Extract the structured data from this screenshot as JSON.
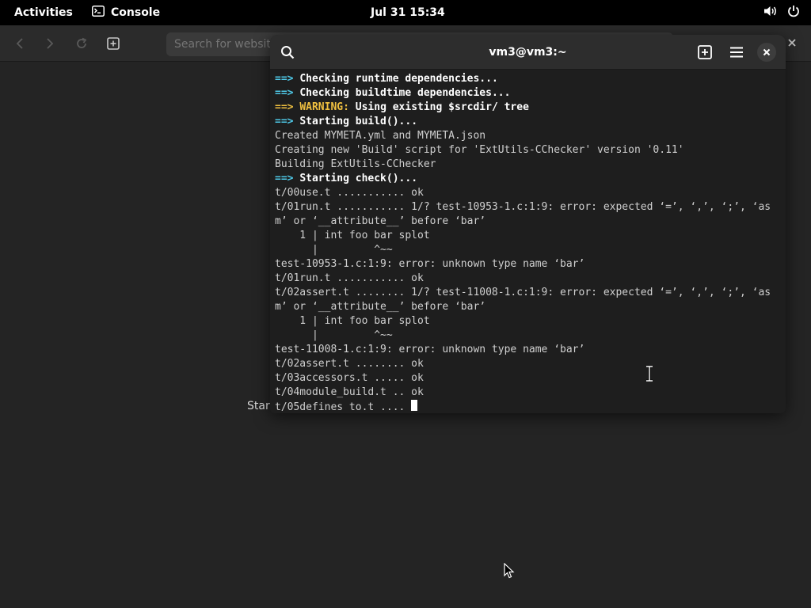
{
  "topbar": {
    "activities": "Activities",
    "app_name": "Console",
    "clock": "Jul 31  15:34",
    "icons": [
      "console-icon",
      "volume-icon",
      "power-icon"
    ]
  },
  "browser": {
    "search_placeholder": "Search for websites",
    "background_text": "Start",
    "icons": [
      "back-icon",
      "forward-icon",
      "reload-icon",
      "new-tab-icon",
      "close-icon"
    ]
  },
  "terminal": {
    "title": "vm3@vm3:~",
    "icons": [
      "search-icon",
      "new-tab-icon",
      "menu-icon",
      "close-icon"
    ],
    "lines": [
      [
        {
          "t": "==> ",
          "c": "arrow"
        },
        {
          "t": "Checking runtime dependencies...",
          "c": "bold"
        }
      ],
      [
        {
          "t": "==> ",
          "c": "arrow"
        },
        {
          "t": "Checking buildtime dependencies...",
          "c": "bold"
        }
      ],
      [
        {
          "t": "==> ",
          "c": "warn"
        },
        {
          "t": "WARNING: ",
          "c": "warn"
        },
        {
          "t": "Using existing $srcdir/ tree",
          "c": "bold"
        }
      ],
      [
        {
          "t": "==> ",
          "c": "arrow"
        },
        {
          "t": "Starting build()...",
          "c": "bold"
        }
      ],
      [
        {
          "t": "Created MYMETA.yml and MYMETA.json",
          "c": ""
        }
      ],
      [
        {
          "t": "Creating new 'Build' script for 'ExtUtils-CChecker' version '0.11'",
          "c": ""
        }
      ],
      [
        {
          "t": "Building ExtUtils-CChecker",
          "c": ""
        }
      ],
      [
        {
          "t": "==> ",
          "c": "arrow"
        },
        {
          "t": "Starting check()...",
          "c": "bold"
        }
      ],
      [
        {
          "t": "t/00use.t ........... ok",
          "c": ""
        }
      ],
      [
        {
          "t": "t/01run.t ........... 1/? test-10953-1.c:1:9: error: expected ‘=’, ‘,’, ‘;’, ‘as",
          "c": ""
        }
      ],
      [
        {
          "t": "m’ or ‘__attribute__’ before ‘bar’",
          "c": ""
        }
      ],
      [
        {
          "t": "    1 | int foo bar splot",
          "c": ""
        }
      ],
      [
        {
          "t": "      |         ^~~",
          "c": ""
        }
      ],
      [
        {
          "t": "test-10953-1.c:1:9: error: unknown type name ‘bar’",
          "c": ""
        }
      ],
      [
        {
          "t": "t/01run.t ........... ok",
          "c": ""
        }
      ],
      [
        {
          "t": "t/02assert.t ........ 1/? test-11008-1.c:1:9: error: expected ‘=’, ‘,’, ‘;’, ‘as",
          "c": ""
        }
      ],
      [
        {
          "t": "m’ or ‘__attribute__’ before ‘bar’",
          "c": ""
        }
      ],
      [
        {
          "t": "    1 | int foo bar splot",
          "c": ""
        }
      ],
      [
        {
          "t": "      |         ^~~",
          "c": ""
        }
      ],
      [
        {
          "t": "test-11008-1.c:1:9: error: unknown type name ‘bar’",
          "c": ""
        }
      ],
      [
        {
          "t": "t/02assert.t ........ ok",
          "c": ""
        }
      ],
      [
        {
          "t": "t/03accessors.t ..... ok",
          "c": ""
        }
      ],
      [
        {
          "t": "t/04module_build.t .. ok",
          "c": ""
        }
      ],
      [
        {
          "t": "t/05defines_to.t .... ",
          "c": ""
        }
      ]
    ]
  },
  "colors": {
    "arrow": "#4fc9e8",
    "warning": "#f0c040",
    "terminal_bg": "#1e1e1e",
    "header_bg": "#2d2d2d",
    "desktop_bg": "#242424"
  }
}
